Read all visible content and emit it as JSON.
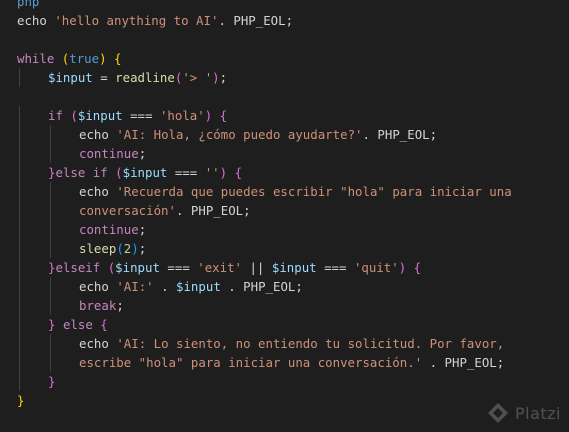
{
  "editor": {
    "language": "php",
    "colors": {
      "background": "#1e1e1e",
      "keyword": "#c586c0",
      "string": "#ce9178",
      "variable": "#9cdcfe",
      "function": "#dcdcaa",
      "constant": "#569cd6",
      "number": "#b5cea8",
      "bracket_level_1": "#ffd700",
      "bracket_level_2": "#da70d6",
      "bracket_level_3": "#179fff"
    },
    "lines": [
      [
        [
          "tag",
          "php"
        ]
      ],
      [
        [
          "plain",
          "echo "
        ],
        [
          "str",
          "'hello anything to AI'"
        ],
        [
          "plain",
          ". PHP_EOL;"
        ]
      ],
      [],
      [
        [
          "ctrl",
          "while"
        ],
        [
          "plain",
          " "
        ],
        [
          "paren1",
          "("
        ],
        [
          "const",
          "true"
        ],
        [
          "paren1",
          ")"
        ],
        [
          "plain",
          " "
        ],
        [
          "paren1",
          "{"
        ]
      ],
      [
        [
          "var",
          "$input"
        ],
        [
          "plain",
          " = "
        ],
        [
          "fn",
          "readline"
        ],
        [
          "paren2",
          "("
        ],
        [
          "str",
          "'> '"
        ],
        [
          "paren2",
          ")"
        ],
        [
          "plain",
          ";"
        ]
      ],
      [],
      [
        [
          "ctrl",
          "if"
        ],
        [
          "plain",
          " "
        ],
        [
          "paren2",
          "("
        ],
        [
          "var",
          "$input"
        ],
        [
          "plain",
          " === "
        ],
        [
          "str",
          "'hola'"
        ],
        [
          "paren2",
          ")"
        ],
        [
          "plain",
          " "
        ],
        [
          "paren2",
          "{"
        ]
      ],
      [
        [
          "plain",
          "echo "
        ],
        [
          "str",
          "'AI: Hola, ¿cómo puedo ayudarte?'"
        ],
        [
          "plain",
          ". PHP_EOL;"
        ]
      ],
      [
        [
          "ctrl",
          "continue"
        ],
        [
          "plain",
          ";"
        ]
      ],
      [
        [
          "paren2",
          "}"
        ],
        [
          "ctrl",
          "else if"
        ],
        [
          "plain",
          " "
        ],
        [
          "paren2",
          "("
        ],
        [
          "var",
          "$input"
        ],
        [
          "plain",
          " === "
        ],
        [
          "str",
          "''"
        ],
        [
          "paren2",
          ")"
        ],
        [
          "plain",
          " "
        ],
        [
          "paren2",
          "{"
        ]
      ],
      [
        [
          "plain",
          "echo "
        ],
        [
          "str",
          "'Recuerda que puedes escribir \"hola\" para iniciar una"
        ]
      ],
      [
        [
          "str",
          "conversación'"
        ],
        [
          "plain",
          ". PHP_EOL;"
        ]
      ],
      [
        [
          "ctrl",
          "continue"
        ],
        [
          "plain",
          ";"
        ]
      ],
      [
        [
          "fn",
          "sleep"
        ],
        [
          "paren3",
          "("
        ],
        [
          "num",
          "2"
        ],
        [
          "paren3",
          ")"
        ],
        [
          "plain",
          ";"
        ]
      ],
      [
        [
          "paren2",
          "}"
        ],
        [
          "ctrl",
          "elseif"
        ],
        [
          "plain",
          " "
        ],
        [
          "paren2",
          "("
        ],
        [
          "var",
          "$input"
        ],
        [
          "plain",
          " === "
        ],
        [
          "str",
          "'exit'"
        ],
        [
          "plain",
          " || "
        ],
        [
          "var",
          "$input"
        ],
        [
          "plain",
          " === "
        ],
        [
          "str",
          "'quit'"
        ],
        [
          "paren2",
          ")"
        ],
        [
          "plain",
          " "
        ],
        [
          "paren2",
          "{"
        ]
      ],
      [
        [
          "plain",
          "echo "
        ],
        [
          "str",
          "'AI:'"
        ],
        [
          "plain",
          " . "
        ],
        [
          "var",
          "$input"
        ],
        [
          "plain",
          " . PHP_EOL;"
        ]
      ],
      [
        [
          "ctrl",
          "break"
        ],
        [
          "plain",
          ";"
        ]
      ],
      [
        [
          "paren2",
          "}"
        ],
        [
          "plain",
          " "
        ],
        [
          "ctrl",
          "else"
        ],
        [
          "plain",
          " "
        ],
        [
          "paren2",
          "{"
        ]
      ],
      [
        [
          "plain",
          "echo "
        ],
        [
          "str",
          "'AI: Lo siento, no entiendo tu solicitud. Por favor,"
        ]
      ],
      [
        [
          "str",
          "escribe \"hola\" para iniciar una conversación.'"
        ],
        [
          "plain",
          " . PHP_EOL;"
        ]
      ],
      [
        [
          "paren2",
          "}"
        ]
      ],
      [
        [
          "paren1",
          "}"
        ]
      ]
    ],
    "indents": [
      0,
      0,
      0,
      0,
      1,
      0,
      1,
      2,
      2,
      1,
      2,
      2,
      2,
      2,
      1,
      2,
      2,
      1,
      2,
      2,
      1,
      0
    ]
  },
  "watermark": {
    "text": "Platzi",
    "icon": "platzi-logo-icon"
  }
}
